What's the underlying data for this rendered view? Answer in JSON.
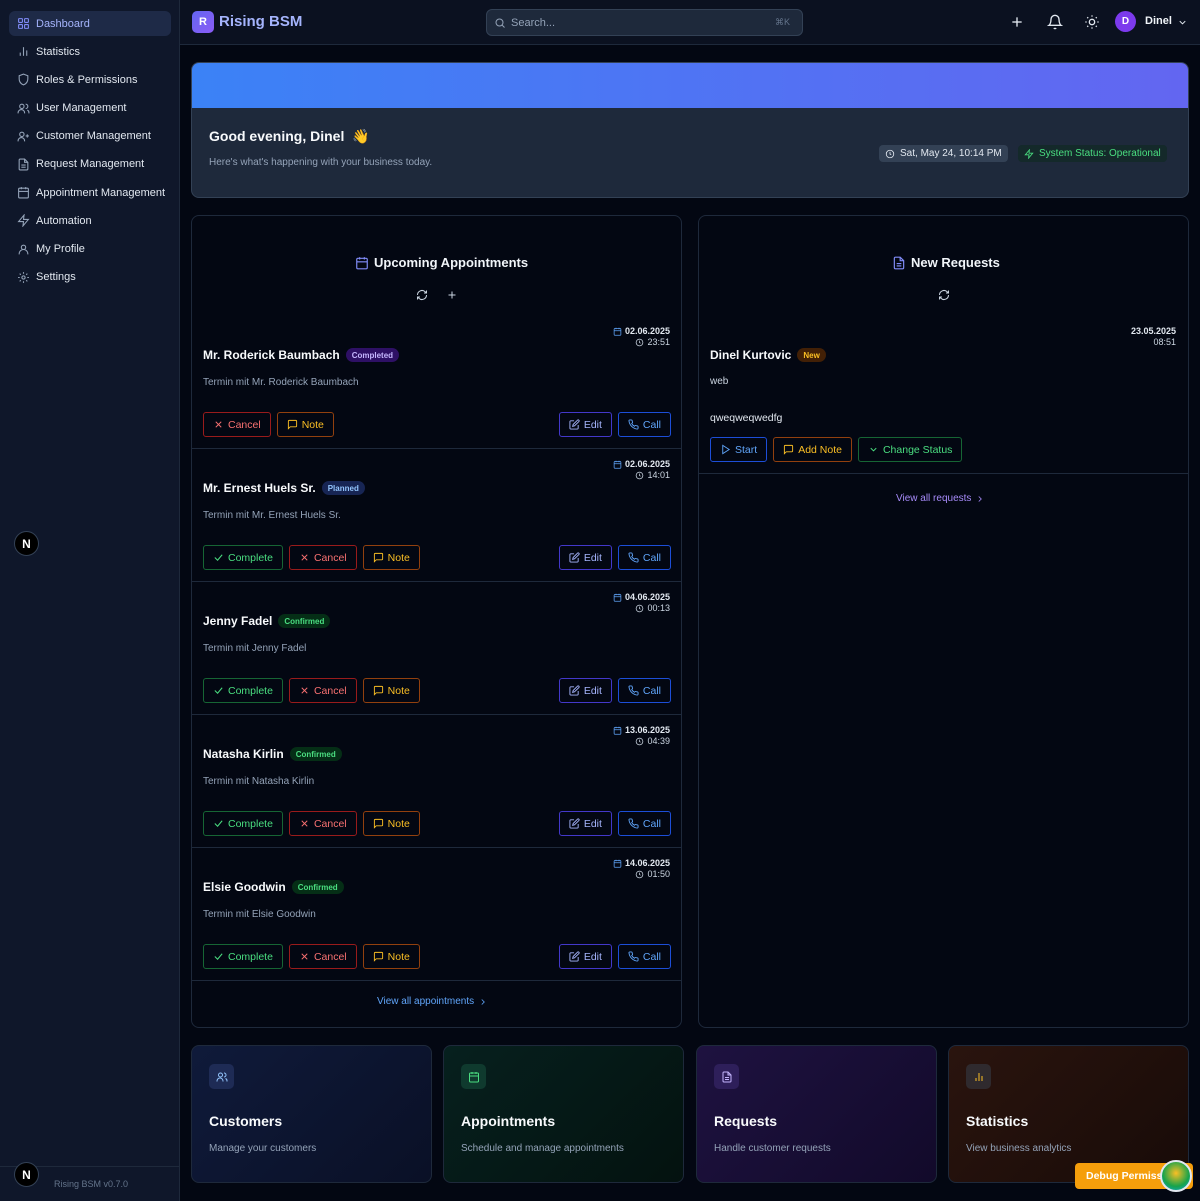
{
  "sidebar": {
    "items": [
      {
        "label": "Dashboard",
        "icon": "layout-grid-icon"
      },
      {
        "label": "Statistics",
        "icon": "bar-chart-icon"
      },
      {
        "label": "Roles & Permissions",
        "icon": "shield-icon"
      },
      {
        "label": "User Management",
        "icon": "users-icon"
      },
      {
        "label": "Customer Management",
        "icon": "user-plus-icon"
      },
      {
        "label": "Request Management",
        "icon": "file-text-icon"
      },
      {
        "label": "Appointment Management",
        "icon": "calendar-icon"
      },
      {
        "label": "Automation",
        "icon": "zap-icon"
      },
      {
        "label": "My Profile",
        "icon": "user-icon"
      },
      {
        "label": "Settings",
        "icon": "gear-icon"
      }
    ],
    "badge_letter": "N",
    "version": "Rising BSM v0.7.0"
  },
  "header": {
    "logo_letter": "R",
    "brand": "Rising BSM",
    "search_placeholder": "Search...",
    "search_shortcut": "⌘K",
    "user_initial": "D",
    "user_name": "Dinel"
  },
  "hero": {
    "greeting": "Good evening, Dinel",
    "wave": "👋",
    "subtitle": "Here's what's happening with your business today.",
    "datetime": "Sat, May 24, 10:14 PM",
    "system_status": "System Status: Operational"
  },
  "appointments": {
    "title": "Upcoming Appointments",
    "view_all": "View all appointments",
    "labels": {
      "complete": "Complete",
      "cancel": "Cancel",
      "note": "Note",
      "edit": "Edit",
      "call": "Call"
    },
    "items": [
      {
        "name": "Mr. Roderick Baumbach",
        "status": "Completed",
        "date": "02.06.2025",
        "time": "23:51",
        "desc": "Termin mit Mr. Roderick Baumbach"
      },
      {
        "name": "Mr. Ernest Huels Sr.",
        "status": "Planned",
        "date": "02.06.2025",
        "time": "14:01",
        "desc": "Termin mit Mr. Ernest Huels Sr."
      },
      {
        "name": "Jenny Fadel",
        "status": "Confirmed",
        "date": "04.06.2025",
        "time": "00:13",
        "desc": "Termin mit Jenny Fadel"
      },
      {
        "name": "Natasha Kirlin",
        "status": "Confirmed",
        "date": "13.06.2025",
        "time": "04:39",
        "desc": "Termin mit Natasha Kirlin"
      },
      {
        "name": "Elsie Goodwin",
        "status": "Confirmed",
        "date": "14.06.2025",
        "time": "01:50",
        "desc": "Termin mit Elsie Goodwin"
      }
    ]
  },
  "requests": {
    "title": "New Requests",
    "view_all": "View all requests",
    "item": {
      "name": "Dinel Kurtovic",
      "status": "New",
      "date": "23.05.2025",
      "time": "08:51",
      "source": "web",
      "message": "qweqweqwedfg",
      "start_label": "Start",
      "add_note_label": "Add Note",
      "change_status_label": "Change Status"
    }
  },
  "tiles": [
    {
      "title": "Customers",
      "subtitle": "Manage your customers",
      "icon": "users-icon"
    },
    {
      "title": "Appointments",
      "subtitle": "Schedule and manage appointments",
      "icon": "calendar-icon"
    },
    {
      "title": "Requests",
      "subtitle": "Handle customer requests",
      "icon": "file-text-icon"
    },
    {
      "title": "Statistics",
      "subtitle": "View business analytics",
      "icon": "bar-chart-icon"
    }
  ],
  "debug_button": "Debug Permiss",
  "colors": {
    "accent": "#6366f1",
    "background": "#030712",
    "sidebar": "#0f172a",
    "success": "#4ade80",
    "danger": "#f87171",
    "warning": "#fbbf24",
    "info": "#60a5fa"
  }
}
